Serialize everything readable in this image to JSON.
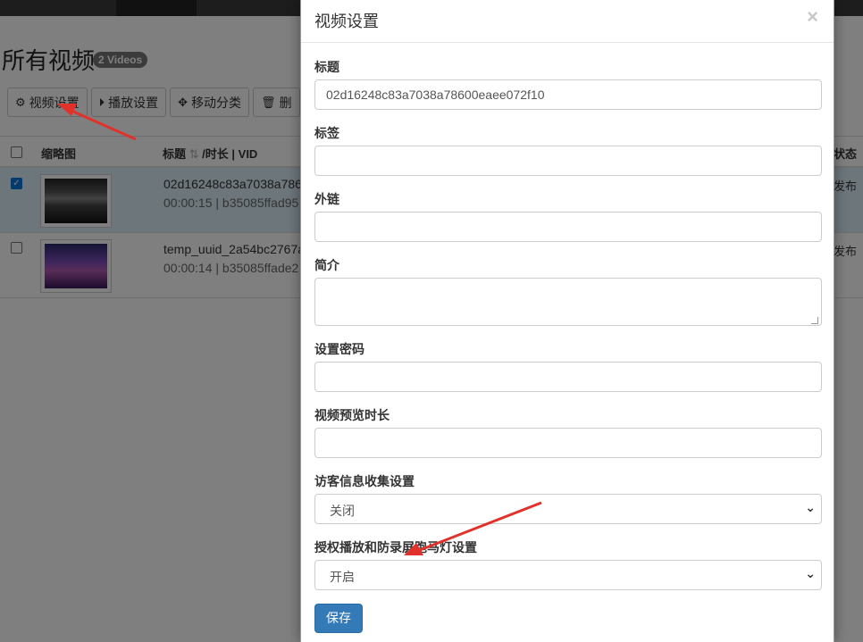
{
  "page": {
    "title": "所有视频",
    "count_badge": "2 Videos"
  },
  "toolbar": {
    "video_settings_label": "视频设置",
    "play_settings_label": "播放设置",
    "move_category_label": "移动分类",
    "delete_label": "删"
  },
  "table": {
    "headers": {
      "thumbnail": "缩略图",
      "title": "标题",
      "duration_vid": "/时长 | VID",
      "status": "状态"
    },
    "rows": [
      {
        "title": "02d16248c83a7038a786",
        "meta": "00:00:15 | b35085ffad95",
        "status": "发布",
        "selected": true
      },
      {
        "title": "temp_uuid_2a54bc2767a",
        "meta": "00:00:14 | b35085ffade2",
        "status": "发布",
        "selected": false
      }
    ]
  },
  "modal": {
    "title": "视频设置",
    "close_label": "×",
    "fields": {
      "title_label": "标题",
      "title_value": "02d16248c83a7038a78600eaee072f10",
      "tags_label": "标签",
      "tags_value": "",
      "external_link_label": "外链",
      "external_link_value": "",
      "intro_label": "简介",
      "intro_value": "",
      "password_label": "设置密码",
      "password_value": "",
      "preview_duration_label": "视频预览时长",
      "preview_duration_value": "",
      "visitor_info_label": "访客信息收集设置",
      "visitor_info_selected": "关闭",
      "auth_play_label": "授权播放和防录屏跑马灯设置",
      "auth_play_selected": "开启"
    },
    "save_label": "保存"
  },
  "colors": {
    "primary": "#337ab7",
    "selected_row": "#d9edf7",
    "annotation_arrow": "#e0322b",
    "checkbox_checked": "#0b74d8"
  }
}
